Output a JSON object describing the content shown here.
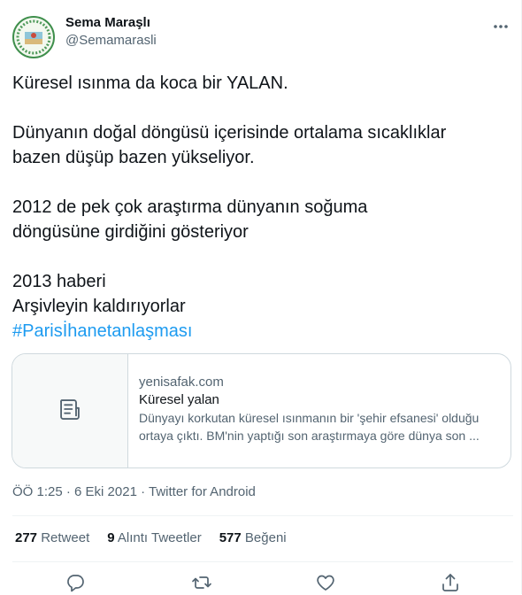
{
  "author": {
    "display_name": "Sema Maraşlı",
    "handle": "@Semamarasli"
  },
  "tweet": {
    "line_1": "Küresel ısınma da koca bir YALAN.",
    "line_2": "Dünyanın doğal döngüsü içerisinde ortalama sıcaklıklar",
    "line_3": "bazen düşüp bazen yükseliyor.",
    "line_4": "2012 de pek çok araştırma dünyanın soğuma",
    "line_5": "döngüsüne girdiğini gösteriyor",
    "line_6": "2013 haberi",
    "line_7": "Arşivleyin kaldırıyorlar",
    "hashtag": "#Parisİhanetanlaşması"
  },
  "card": {
    "domain": "yenisafak.com",
    "title": "Küresel yalan",
    "desc_line_1": "Dünyayı korkutan küresel ısınmanın bir 'şehir efsanesi' olduğu",
    "desc_line_2": "ortaya çıktı. BM'nin yaptığı son araştırmaya göre dünya son ...",
    "icon": "article-icon"
  },
  "meta": {
    "time": "ÖÖ 1:25",
    "separator_1": " · ",
    "date": "6 Eki 2021",
    "separator_2": " · ",
    "source": "Twitter for Android"
  },
  "stats": {
    "retweets_count": "277",
    "retweets_label": "Retweet",
    "quotes_count": "9",
    "quotes_label": "Alıntı Tweetler",
    "likes_count": "577",
    "likes_label": "Beğeni"
  },
  "icons": {
    "more": "more-horizontal-icon",
    "reply": "reply-icon",
    "retweet": "retweet-icon",
    "like": "heart-icon",
    "share": "share-icon"
  },
  "colors": {
    "link": "#1d9bf0",
    "text_primary": "#0f1419",
    "text_secondary": "#536471",
    "border": "#cfd9de"
  }
}
